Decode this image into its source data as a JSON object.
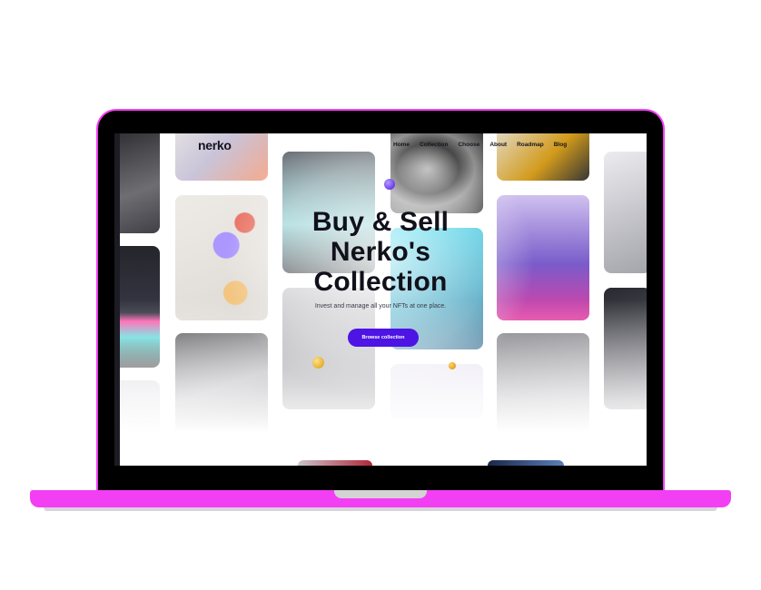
{
  "device": {
    "frame_color": "#f23ff4",
    "screen_bezel_color": "#000000"
  },
  "site": {
    "logo": "nerko",
    "nav": [
      "Home",
      "Collection",
      "Choose",
      "About",
      "Roadmap",
      "Blog"
    ],
    "hero": {
      "title_line1": "Buy & Sell",
      "title_line2": "Nerko's",
      "title_line3": "Collection",
      "subtitle": "Invest and manage all your NFTs at one place.",
      "cta_label": "Browse collection"
    },
    "colors": {
      "accent": "#4d14e4",
      "text": "#11111b"
    }
  }
}
